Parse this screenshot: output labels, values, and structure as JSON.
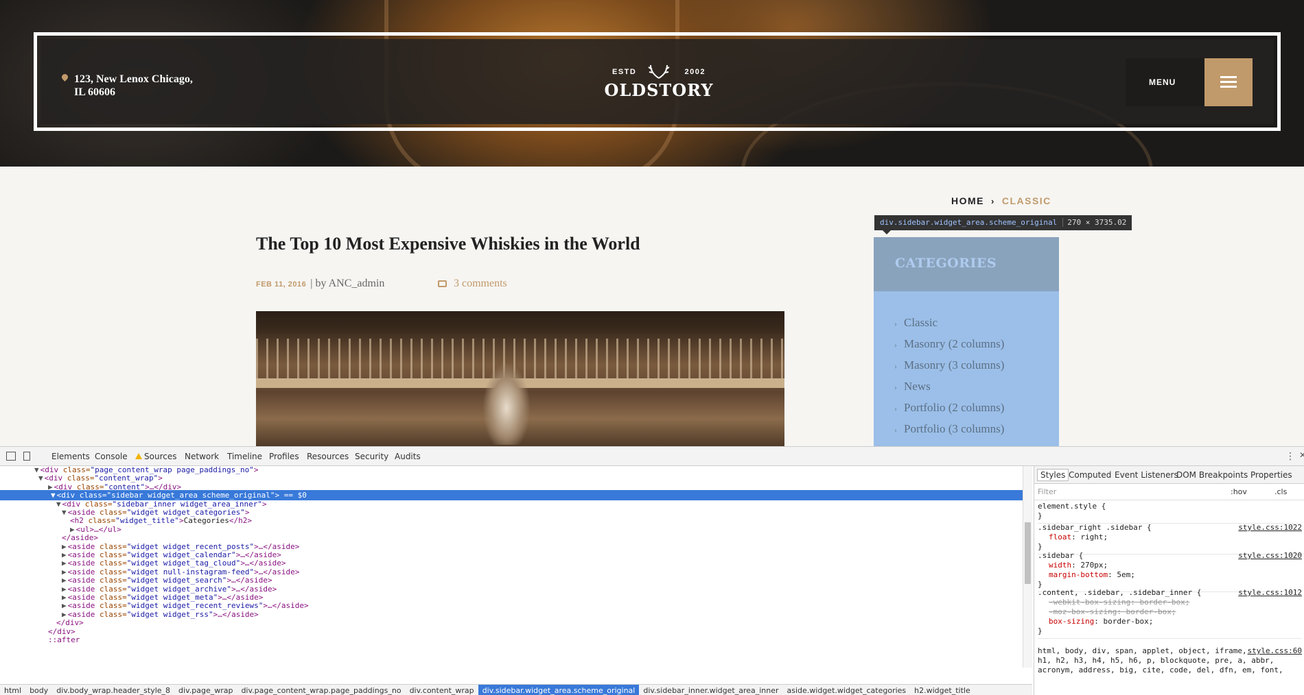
{
  "header": {
    "address_line1": "123, New Lenox Chicago,",
    "address_line2": "IL 60606",
    "logo_estd": "ESTD",
    "logo_year": "2002",
    "logo_name": "OLDSTORY",
    "menu_label": "MENU"
  },
  "breadcrumbs": {
    "home": "HOME",
    "current": "CLASSIC"
  },
  "inspect_tooltip": {
    "tag": "div.sidebar.widget_area.scheme_original",
    "size": "270 × 3735.02"
  },
  "post": {
    "title": "The Top 10 Most Expensive Whiskies in the World",
    "date": "FEB 11, 2016",
    "byline": "| by ANC_admin",
    "comments": "3 comments"
  },
  "sidebar": {
    "title": "CATEGORIES",
    "items": [
      "Classic",
      "Masonry (2 columns)",
      "Masonry (3 columns)",
      "News",
      "Portfolio (2 columns)",
      "Portfolio (3 columns)"
    ]
  },
  "devtools": {
    "tabs": [
      "Elements",
      "Console",
      "Sources",
      "Network",
      "Timeline",
      "Profiles",
      "Resources",
      "Security",
      "Audits"
    ],
    "dom_lines": [
      {
        "open": "<div ",
        "attr": "class",
        "val": "\"page_content_wrap page_paddings_no\"",
        "rest": ">"
      },
      {
        "open": "<div ",
        "attr": "class",
        "val": "\"content_wrap\"",
        "rest": ">"
      },
      {
        "open": "<div ",
        "attr": "class",
        "val": "\"content\"",
        "rest": ">…</div>"
      },
      {
        "open": "<div ",
        "attr": "class",
        "val": "\"sidebar widget_area scheme_original\"",
        "rest": "> == $0"
      },
      {
        "open": "<div ",
        "attr": "class",
        "val": "\"sidebar_inner widget_area_inner\"",
        "rest": ">"
      },
      {
        "open": "<aside ",
        "attr": "class",
        "val": "\"widget widget_categories\"",
        "rest": ">"
      },
      {
        "open": "<h2 ",
        "attr": "class",
        "val": "\"widget_title\"",
        "rest": ">",
        "text": "Categories",
        "close": "</h2>"
      },
      {
        "open": "<ul>",
        "attr": "",
        "val": "",
        "rest": "…</ul>"
      },
      {
        "open": "</aside>",
        "attr": "",
        "val": "",
        "rest": ""
      },
      {
        "open": "<aside ",
        "attr": "class",
        "val": "\"widget widget_recent_posts\"",
        "rest": ">…</aside>"
      },
      {
        "open": "<aside ",
        "attr": "class",
        "val": "\"widget widget_calendar\"",
        "rest": ">…</aside>"
      },
      {
        "open": "<aside ",
        "attr": "class",
        "val": "\"widget widget_tag_cloud\"",
        "rest": ">…</aside>"
      },
      {
        "open": "<aside ",
        "attr": "class",
        "val": "\"widget null-instagram-feed\"",
        "rest": ">…</aside>"
      },
      {
        "open": "<aside ",
        "attr": "class",
        "val": "\"widget widget_search\"",
        "rest": ">…</aside>"
      },
      {
        "open": "<aside ",
        "attr": "class",
        "val": "\"widget widget_archive\"",
        "rest": ">…</aside>"
      },
      {
        "open": "<aside ",
        "attr": "class",
        "val": "\"widget widget_meta\"",
        "rest": ">…</aside>"
      },
      {
        "open": "<aside ",
        "attr": "class",
        "val": "\"widget widget_recent_reviews\"",
        "rest": ">…</aside>"
      },
      {
        "open": "<aside ",
        "attr": "class",
        "val": "\"widget widget_rss\"",
        "rest": ">…</aside>"
      },
      {
        "open": "</div>",
        "attr": "",
        "val": "",
        "rest": ""
      },
      {
        "open": "</div>",
        "attr": "",
        "val": "",
        "rest": ""
      },
      {
        "open": "::after",
        "attr": "",
        "val": "",
        "rest": ""
      }
    ],
    "breadcrumb": [
      "html",
      "body",
      "div.body_wrap.header_style_8",
      "div.page_wrap",
      "div.page_content_wrap.page_paddings_no",
      "div.content_wrap",
      "div.sidebar.widget_area.scheme_original",
      "div.sidebar_inner.widget_area_inner",
      "aside.widget.widget_categories",
      "h2.widget_title"
    ],
    "style_tabs": [
      "Styles",
      "Computed",
      "Event Listeners",
      "DOM Breakpoints",
      "Properties"
    ],
    "filter_placeholder": "Filter",
    "filter_hov": ":hov",
    "filter_cls": ".cls",
    "rules": [
      {
        "selector": "element.style {",
        "source": "",
        "props": []
      },
      {
        "selector": ".sidebar_right .sidebar {",
        "source": "style.css:1022",
        "props": [
          {
            "name": "float",
            "value": "right;",
            "strike": false
          }
        ]
      },
      {
        "selector": ".sidebar {",
        "source": "style.css:1020",
        "props": [
          {
            "name": "width",
            "value": "270px;",
            "strike": false
          },
          {
            "name": "margin-bottom",
            "value": "5em;",
            "strike": false
          }
        ]
      },
      {
        "selector": ".content, .sidebar, .sidebar_inner {",
        "source": "style.css:1012",
        "props": [
          {
            "name": "-webkit-box-sizing",
            "value": "border-box;",
            "strike": true
          },
          {
            "name": "-moz-box-sizing",
            "value": "border-box;",
            "strike": true
          },
          {
            "name": "box-sizing",
            "value": "border-box;",
            "strike": false
          }
        ]
      },
      {
        "selector": "html, body, div, span, applet, object, iframe,",
        "source": "style.css:60",
        "props": []
      }
    ],
    "rule_tail": [
      "h1, h2, h3, h4, h5, h6, p, blockquote, pre, a, abbr,",
      "acronym, address, big, cite, code, del, dfn, em, font,"
    ]
  }
}
